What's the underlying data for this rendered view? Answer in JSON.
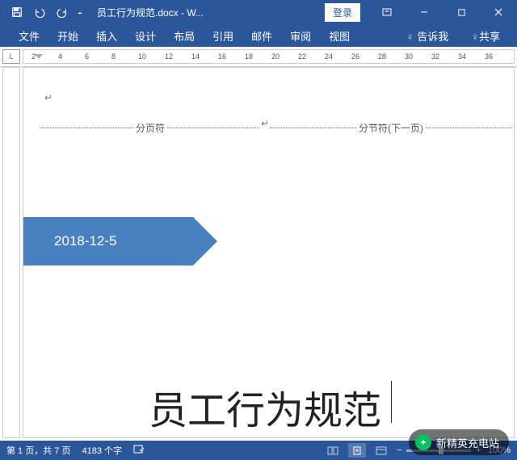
{
  "titlebar": {
    "filename": "员工行为规范.docx - W...",
    "login": "登录"
  },
  "tabs": {
    "file": "文件",
    "home": "开始",
    "insert": "插入",
    "design": "设计",
    "layout": "布局",
    "references": "引用",
    "mailings": "邮件",
    "review": "审阅",
    "view": "视图",
    "tellme": "告诉我",
    "share": "共享"
  },
  "ruler": {
    "corner": "L",
    "marks": [
      "2",
      "4",
      "6",
      "8",
      "10",
      "12",
      "14",
      "16",
      "18",
      "20",
      "22",
      "24",
      "26",
      "28",
      "30",
      "32",
      "34",
      "36"
    ]
  },
  "document": {
    "pagebreak": "分页符",
    "sectionbreak": "分节符(下一页)",
    "date": "2018-12-5",
    "title": "员工行为规范"
  },
  "statusbar": {
    "page": "第 1 页，共 7 页",
    "words": "4183 个字",
    "zoom": "100%"
  },
  "overlay": {
    "name": "新精英充电站"
  }
}
